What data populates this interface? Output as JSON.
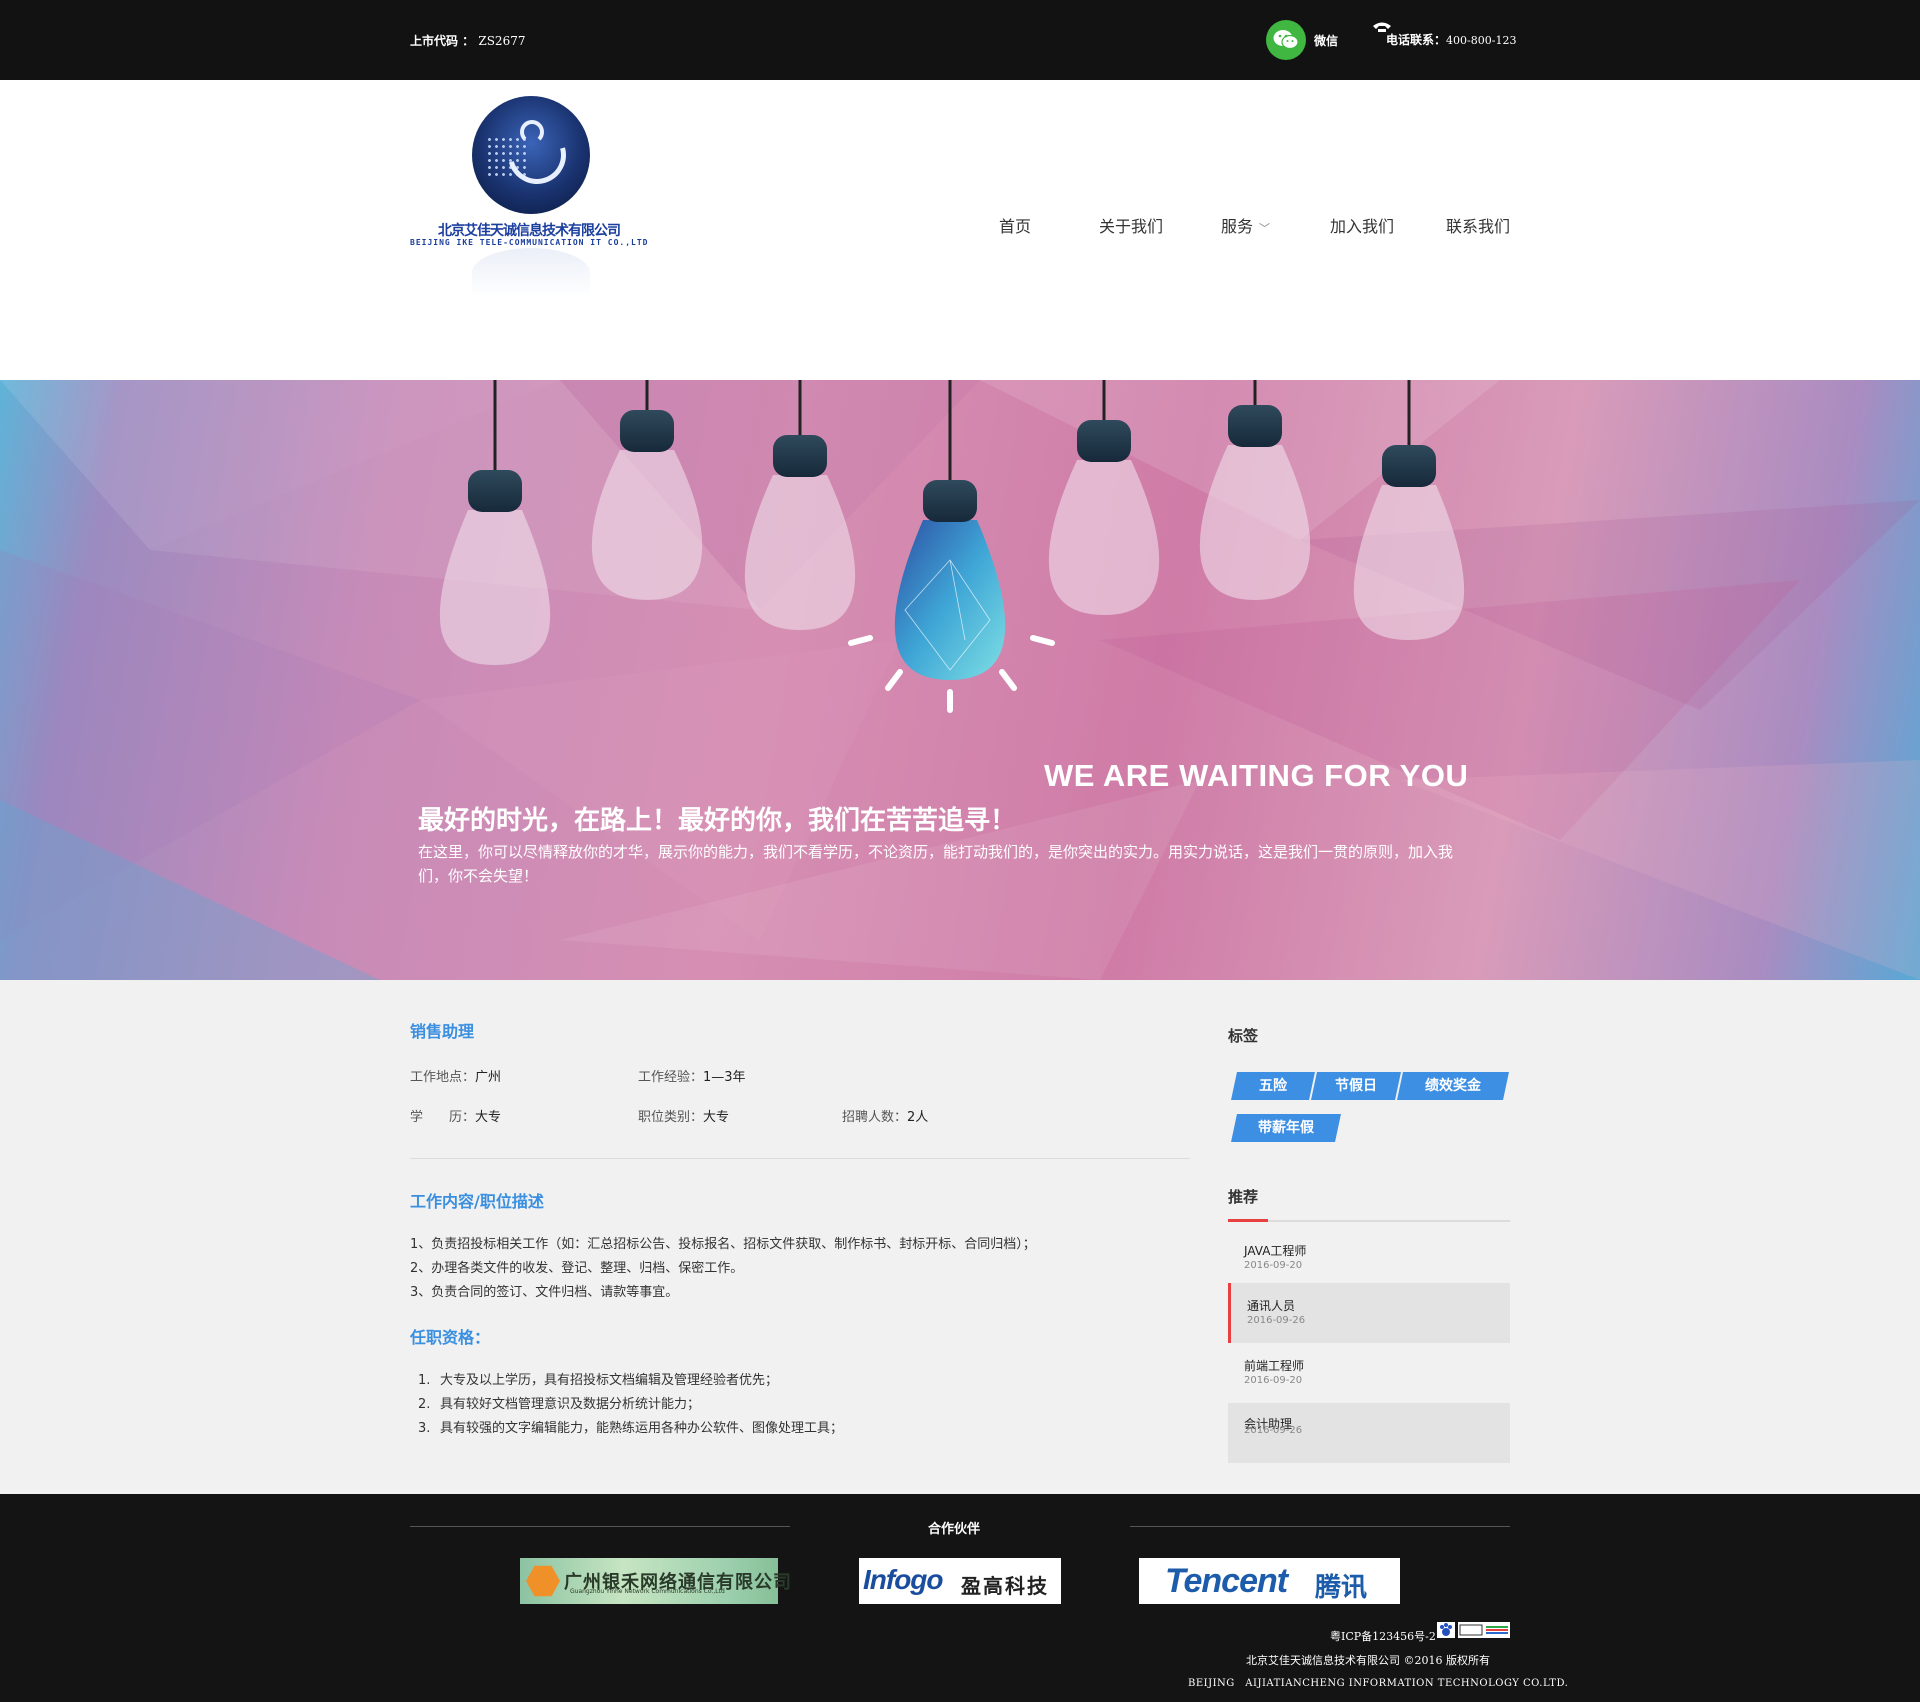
{
  "topbar": {
    "stock_label": "上市代码 ：",
    "stock_code": "ZS2677",
    "wechat_label": "微信",
    "phone_label": "电话联系：",
    "phone_number": "400-800-123"
  },
  "logo": {
    "cn_name": "北京艾佳天诚信息技术有限公司",
    "en_name": "BEIJING IKE TELE-COMMUNICATION IT CO.,LTD"
  },
  "nav": {
    "items": [
      {
        "label": "首页"
      },
      {
        "label": "关于我们"
      },
      {
        "label": "服务"
      },
      {
        "label": "加入我们"
      },
      {
        "label": "联系我们"
      }
    ]
  },
  "banner": {
    "title_en": "WE ARE WAITING FOR YOU",
    "title_cn": "最好的时光，在路上！最好的你，我们在苦苦追寻！",
    "description": "在这里，你可以尽情释放你的才华，展示你的能力，我们不看学历，不论资历，能打动我们的，是你突出的实力。用实力说话，这是我们一贯的原则，加入我们，你不会失望！"
  },
  "job": {
    "title": "销售助理",
    "location_label": "工作地点：",
    "location": "广州",
    "experience_label": "工作经验：",
    "experience": "1—3年",
    "education_label": "学　　历：",
    "education": "大专",
    "category_label": "职位类别：",
    "category": "大专",
    "headcount_label": "招聘人数：",
    "headcount": "2人",
    "duties_title": "工作内容/职位描述",
    "duties": [
      "1、负责招投标相关工作（如：汇总招标公告、投标报名、招标文件获取、制作标书、封标开标、合同归档）；",
      "2、办理各类文件的收发、登记、整理、归档、保密工作。",
      "3、负责合同的签订、文件归档、请款等事宜。"
    ],
    "requirements_title": "任职资格：",
    "requirements": [
      {
        "n": "1.",
        "text": "大专及以上学历，具有招投标文档编辑及管理经验者优先；"
      },
      {
        "n": "2.",
        "text": "具有较好文档管理意识及数据分析统计能力；"
      },
      {
        "n": "3.",
        "text": "具有较强的文字编辑能力，能熟练运用各种办公软件、图像处理工具；"
      }
    ]
  },
  "sidebar": {
    "tags_title": "标签",
    "tags": [
      "五险",
      "节假日",
      "绩效奖金",
      "带薪年假"
    ],
    "recommend_title": "推荐",
    "recommend": [
      {
        "title": "JAVA工程师",
        "date": "2016-09-20"
      },
      {
        "title": "通讯人员",
        "date": "2016-09-26"
      },
      {
        "title": "前端工程师",
        "date": "2016-09-20"
      },
      {
        "title": "会计助理",
        "date": "2016-09-26"
      }
    ]
  },
  "footer": {
    "partners_title": "合作伙伴",
    "partner1": "广州银禾网络通信有限公司",
    "partner1_sub": "Guangzhou Yinhe Network Communications Co.,Ltd",
    "partner2_a": "Infogo",
    "partner2_b": "盈高科技",
    "partner3_a": "Tencent",
    "partner3_b": "腾讯",
    "icp": "粤ICP备123456号-2",
    "copyright": "北京艾佳天诚信息技术有限公司 ©2016 版权所有",
    "en_name": "BEIJING　AIJIATIANCHENG INFORMATION TECHNOLOGY CO.LTD."
  },
  "colors": {
    "accent": "#3b8fe0",
    "tag": "#3d8fe3",
    "highlight": "#e84040",
    "wechat": "#3fb741"
  }
}
